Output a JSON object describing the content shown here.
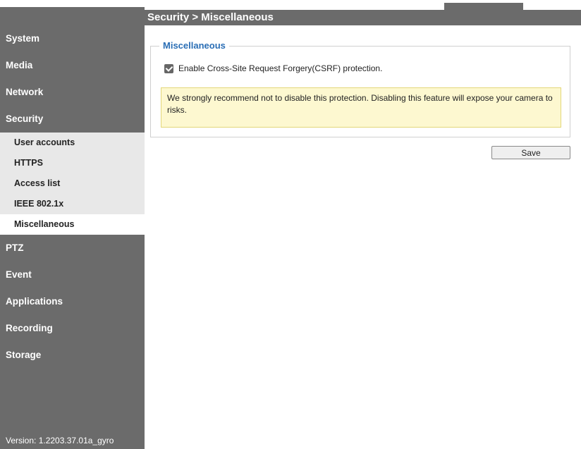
{
  "header": {
    "title": "Security  > Miscellaneous"
  },
  "sidebar": {
    "items_top": [
      {
        "label": "System"
      },
      {
        "label": "Media"
      },
      {
        "label": "Network"
      },
      {
        "label": "Security"
      }
    ],
    "security_submenu": [
      {
        "label": "User accounts"
      },
      {
        "label": "HTTPS"
      },
      {
        "label": "Access list"
      },
      {
        "label": "IEEE 802.1x"
      },
      {
        "label": "Miscellaneous",
        "active": true
      }
    ],
    "items_bottom": [
      {
        "label": "PTZ"
      },
      {
        "label": "Event"
      },
      {
        "label": "Applications"
      },
      {
        "label": "Recording"
      },
      {
        "label": "Storage"
      }
    ],
    "version": "Version: 1.2203.37.01a_gyro"
  },
  "main": {
    "section_title": "Miscellaneous",
    "csrf": {
      "label": "Enable Cross-Site Request Forgery(CSRF) protection.",
      "checked": true
    },
    "warning": "We strongly recommend not to disable this protection. Disabling this feature will expose your camera to risks.",
    "save_label": "Save"
  },
  "colors": {
    "sidebar_bg": "#6b6b6b",
    "legend": "#2a6eb5",
    "warning_bg": "#fdf8d0"
  }
}
